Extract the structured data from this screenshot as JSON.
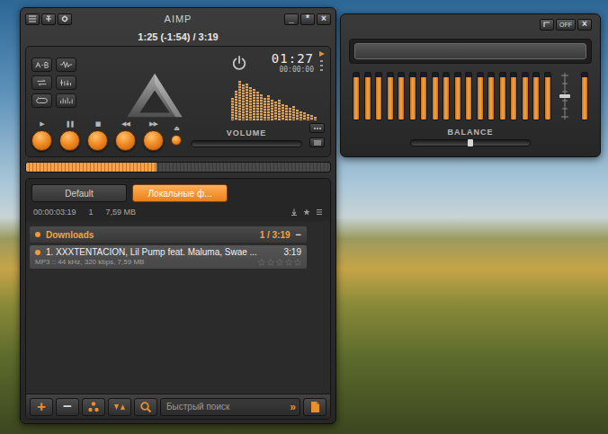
{
  "main_window": {
    "title": "AIMP",
    "controls": [
      "_",
      "*",
      "×"
    ]
  },
  "player": {
    "time": "1:25 (-1:54) / 3:19",
    "clock": "01:27",
    "clock_sub": "00:00:00",
    "spectrum": [
      0.55,
      0.72,
      0.95,
      0.86,
      0.9,
      0.8,
      0.76,
      0.7,
      0.62,
      0.55,
      0.6,
      0.5,
      0.46,
      0.5,
      0.4,
      0.36,
      0.3,
      0.34,
      0.26,
      0.22,
      0.2,
      0.16,
      0.12,
      0.08
    ],
    "transport": [
      {
        "glyph": "▶",
        "kind": "round"
      },
      {
        "glyph": "❚❚",
        "kind": "round"
      },
      {
        "glyph": "■",
        "kind": "round"
      },
      {
        "glyph": "◀◀",
        "kind": "round"
      },
      {
        "glyph": "▶▶",
        "kind": "round"
      },
      {
        "glyph": "⏏",
        "kind": "small"
      }
    ],
    "volume": {
      "label": "VOLUME"
    },
    "seek": {
      "level": 0.43
    }
  },
  "playlist": {
    "tabs": [
      {
        "label": "Default",
        "selected": false
      },
      {
        "label": "Локальные ф...",
        "selected": true
      }
    ],
    "summary": {
      "duration": "00:00:03:19",
      "count": "1",
      "size": "7,59 MB"
    },
    "groups": [
      {
        "title": "Downloads",
        "info": "1 / 3:19",
        "toggle": "−",
        "expanded": true,
        "tracks": [
          {
            "title": "1. XXXTENTACION, Lil Pump feat. Maluma, Swae ...",
            "duration": "3:19",
            "details": "MP3 :: 44 kHz, 320 kbps, 7,59 MB",
            "stars": 0,
            "selected": true
          }
        ]
      }
    ],
    "toolbar": {
      "add": "+",
      "remove": "−",
      "search_placeholder": "Быстрый поиск",
      "search_button": "»"
    }
  },
  "equalizer": {
    "toggle": "OFF",
    "close": "×",
    "bands": [
      0.9,
      0.9,
      0.9,
      0.9,
      0.9,
      0.9,
      0.9,
      0.9,
      0.9,
      0.9,
      0.9,
      0.9,
      0.9,
      0.9,
      0.9,
      0.9,
      0.9,
      0.9
    ],
    "preamp_level": 0.5,
    "master_level": 0.9,
    "balance": {
      "label": "BALANCE",
      "level": 0.5
    }
  }
}
